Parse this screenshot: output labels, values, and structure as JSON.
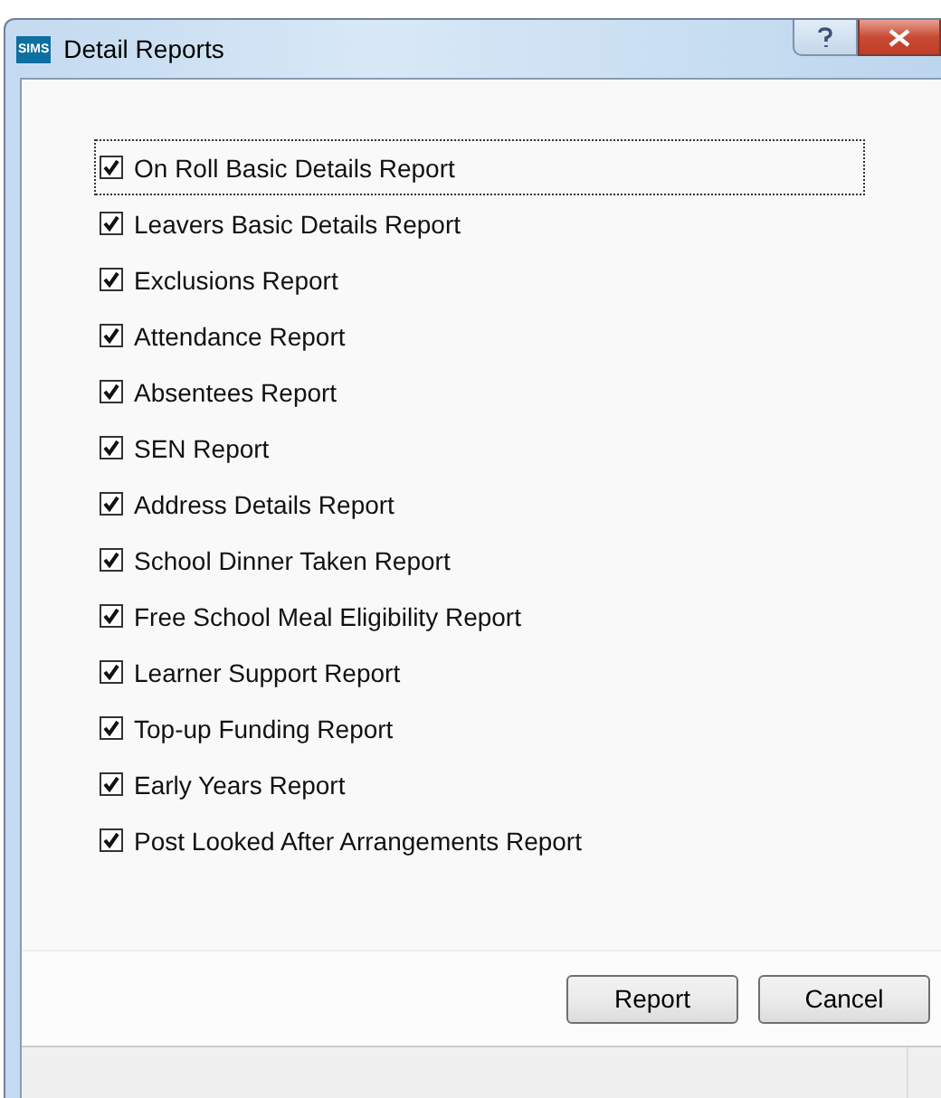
{
  "window": {
    "title": "Detail Reports",
    "logo": "SIMS"
  },
  "reports": [
    {
      "label": "On Roll Basic Details Report",
      "checked": true,
      "focused": true
    },
    {
      "label": "Leavers Basic Details Report",
      "checked": true,
      "focused": false
    },
    {
      "label": "Exclusions Report",
      "checked": true,
      "focused": false
    },
    {
      "label": "Attendance Report",
      "checked": true,
      "focused": false
    },
    {
      "label": "Absentees Report",
      "checked": true,
      "focused": false
    },
    {
      "label": "SEN Report",
      "checked": true,
      "focused": false
    },
    {
      "label": "Address Details Report",
      "checked": true,
      "focused": false
    },
    {
      "label": "School Dinner Taken Report",
      "checked": true,
      "focused": false
    },
    {
      "label": "Free School Meal Eligibility Report",
      "checked": true,
      "focused": false
    },
    {
      "label": "Learner Support Report",
      "checked": true,
      "focused": false
    },
    {
      "label": "Top-up Funding Report",
      "checked": true,
      "focused": false
    },
    {
      "label": "Early Years Report",
      "checked": true,
      "focused": false
    },
    {
      "label": "Post Looked After Arrangements Report",
      "checked": true,
      "focused": false
    }
  ],
  "buttons": [
    "Report",
    "Cancel"
  ]
}
